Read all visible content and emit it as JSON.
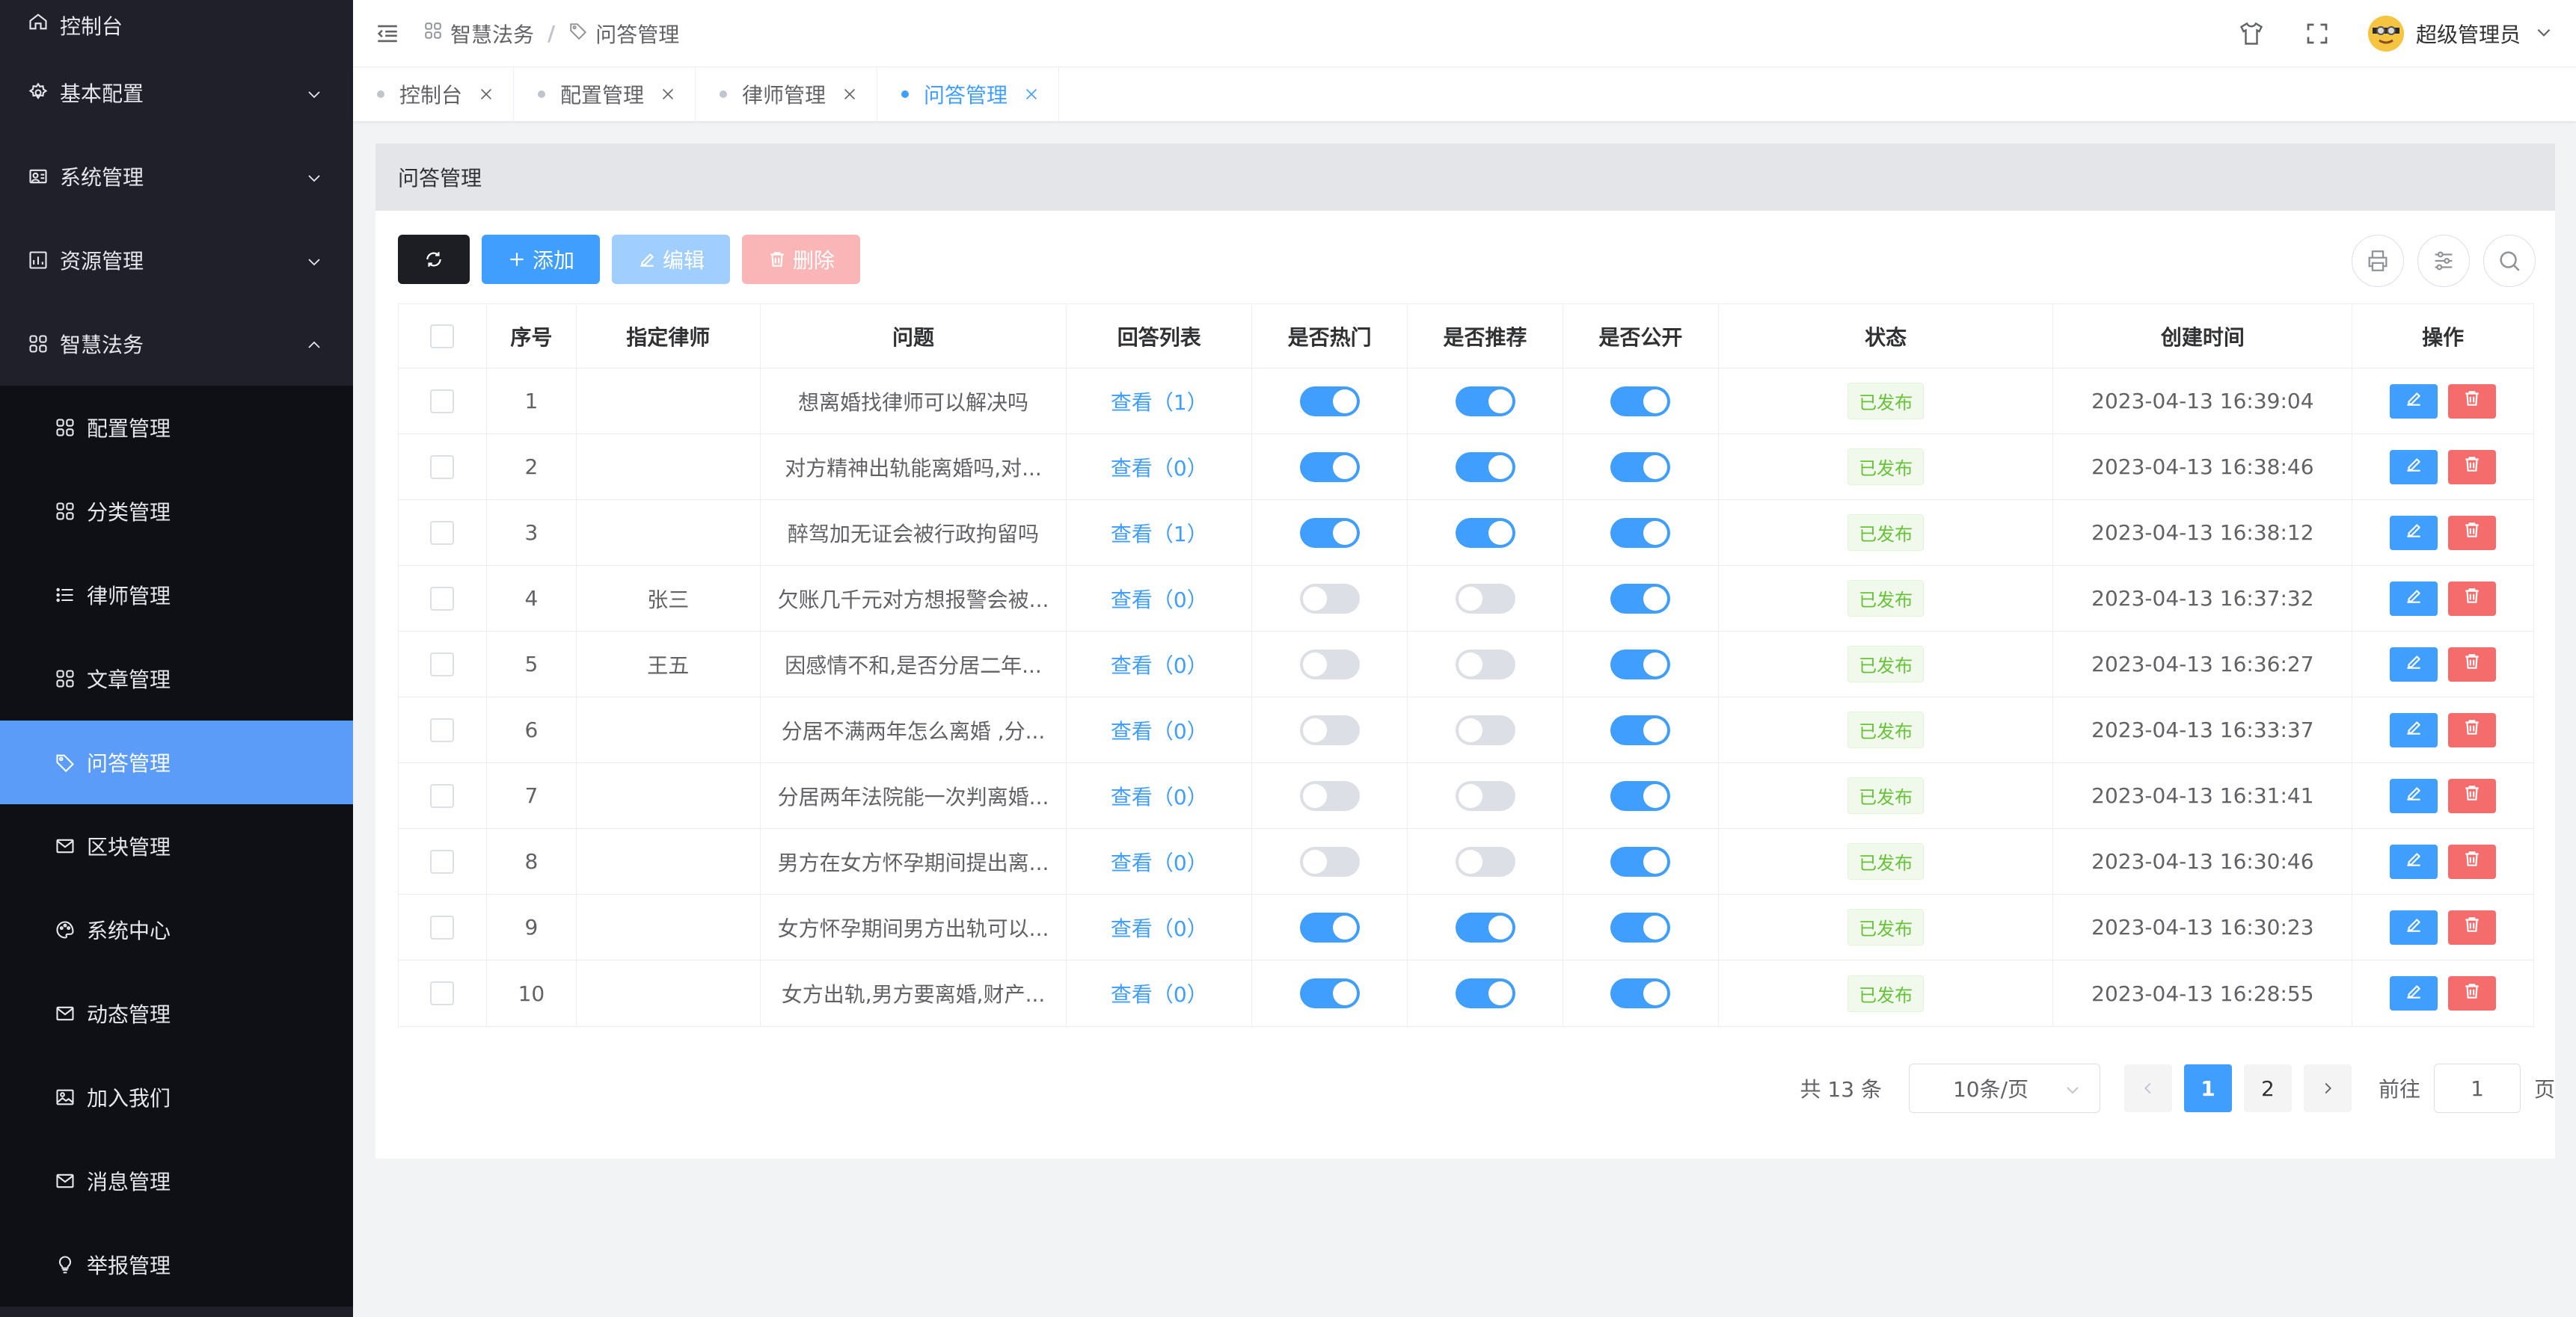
{
  "sidebar": {
    "items": [
      {
        "label": "控制台",
        "icon": "home-icon",
        "type": "top"
      },
      {
        "label": "基本配置",
        "icon": "gear-icon",
        "type": "top",
        "arrow": "chevron-down-icon"
      },
      {
        "label": "系统管理",
        "icon": "users-icon",
        "type": "top",
        "arrow": "chevron-down-icon"
      },
      {
        "label": "资源管理",
        "icon": "chart-icon",
        "type": "top",
        "arrow": "chevron-down-icon"
      },
      {
        "label": "智慧法务",
        "icon": "grid-icon",
        "type": "top",
        "arrow": "chevron-up-icon"
      },
      {
        "label": "配置管理",
        "icon": "grid-icon",
        "type": "sub"
      },
      {
        "label": "分类管理",
        "icon": "grid-icon",
        "type": "sub"
      },
      {
        "label": "律师管理",
        "icon": "list-icon",
        "type": "sub"
      },
      {
        "label": "文章管理",
        "icon": "grid-icon",
        "type": "sub"
      },
      {
        "label": "问答管理",
        "icon": "tag-icon",
        "type": "sub",
        "active": true
      },
      {
        "label": "区块管理",
        "icon": "mail-icon",
        "type": "sub"
      },
      {
        "label": "系统中心",
        "icon": "palette-icon",
        "type": "sub"
      },
      {
        "label": "动态管理",
        "icon": "mail-icon",
        "type": "sub"
      },
      {
        "label": "加入我们",
        "icon": "picture-icon",
        "type": "sub"
      },
      {
        "label": "消息管理",
        "icon": "mail-icon",
        "type": "sub"
      },
      {
        "label": "举报管理",
        "icon": "bulb-icon",
        "type": "sub"
      }
    ]
  },
  "header": {
    "breadcrumb": [
      "智慧法务",
      "问答管理"
    ],
    "separator": "/",
    "user_name": "超级管理员"
  },
  "tabs": [
    {
      "label": "控制台",
      "active": false
    },
    {
      "label": "配置管理",
      "active": false
    },
    {
      "label": "律师管理",
      "active": false
    },
    {
      "label": "问答管理",
      "active": true
    }
  ],
  "card": {
    "title": "问答管理"
  },
  "toolbar": {
    "add_label": "添加",
    "edit_label": "编辑",
    "delete_label": "删除"
  },
  "table": {
    "columns": [
      "",
      "序号",
      "指定律师",
      "问题",
      "回答列表",
      "是否热门",
      "是否推荐",
      "是否公开",
      "状态",
      "创建时间",
      "操作"
    ],
    "rows": [
      {
        "no": "1",
        "lawyer": "",
        "question": "想离婚找律师可以解决吗",
        "answers": "查看（1）",
        "hot": true,
        "recommend": true,
        "public": true,
        "status": "已发布",
        "created": "2023-04-13 16:39:04"
      },
      {
        "no": "2",
        "lawyer": "",
        "question": "对方精神出轨能离婚吗,对...",
        "answers": "查看（0）",
        "hot": true,
        "recommend": true,
        "public": true,
        "status": "已发布",
        "created": "2023-04-13 16:38:46"
      },
      {
        "no": "3",
        "lawyer": "",
        "question": "醉驾加无证会被行政拘留吗",
        "answers": "查看（1）",
        "hot": true,
        "recommend": true,
        "public": true,
        "status": "已发布",
        "created": "2023-04-13 16:38:12"
      },
      {
        "no": "4",
        "lawyer": "张三",
        "question": "欠账几千元对方想报警会被...",
        "answers": "查看（0）",
        "hot": false,
        "recommend": false,
        "public": true,
        "status": "已发布",
        "created": "2023-04-13 16:37:32"
      },
      {
        "no": "5",
        "lawyer": "王五",
        "question": "因感情不和,是否分居二年...",
        "answers": "查看（0）",
        "hot": false,
        "recommend": false,
        "public": true,
        "status": "已发布",
        "created": "2023-04-13 16:36:27"
      },
      {
        "no": "6",
        "lawyer": "",
        "question": "分居不满两年怎么离婚 ,分...",
        "answers": "查看（0）",
        "hot": false,
        "recommend": false,
        "public": true,
        "status": "已发布",
        "created": "2023-04-13 16:33:37"
      },
      {
        "no": "7",
        "lawyer": "",
        "question": "分居两年法院能一次判离婚...",
        "answers": "查看（0）",
        "hot": false,
        "recommend": false,
        "public": true,
        "status": "已发布",
        "created": "2023-04-13 16:31:41"
      },
      {
        "no": "8",
        "lawyer": "",
        "question": "男方在女方怀孕期间提出离...",
        "answers": "查看（0）",
        "hot": false,
        "recommend": false,
        "public": true,
        "status": "已发布",
        "created": "2023-04-13 16:30:46"
      },
      {
        "no": "9",
        "lawyer": "",
        "question": "女方怀孕期间男方出轨可以...",
        "answers": "查看（0）",
        "hot": true,
        "recommend": true,
        "public": true,
        "status": "已发布",
        "created": "2023-04-13 16:30:23"
      },
      {
        "no": "10",
        "lawyer": "",
        "question": "女方出轨,男方要离婚,财产...",
        "answers": "查看（0）",
        "hot": true,
        "recommend": true,
        "public": true,
        "status": "已发布",
        "created": "2023-04-13 16:28:55"
      }
    ]
  },
  "pagination": {
    "total_text": "共 13 条",
    "page_size": "10条/页",
    "pages": [
      "1",
      "2"
    ],
    "current_page": "1",
    "goto_label": "前往",
    "goto_value": "1",
    "page_suffix": "页"
  },
  "colors": {
    "primary": "#409eff",
    "sidebar_bg": "#1f2029",
    "sidebar_active": "#5a9cf8",
    "danger": "#f56c6c",
    "success": "#67c23a"
  }
}
